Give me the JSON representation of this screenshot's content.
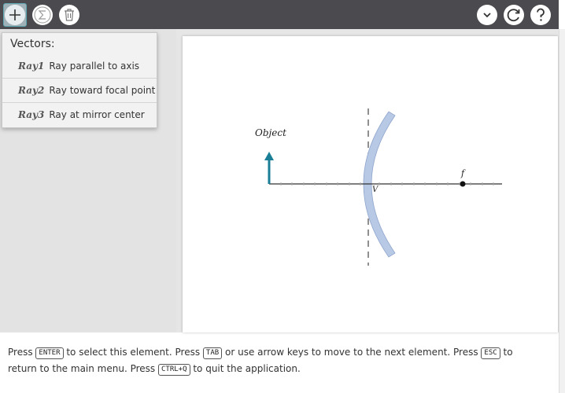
{
  "toolbar": {
    "add_icon": "plus-icon",
    "sum_icon": "sigma-icon",
    "delete_icon": "trash-icon",
    "dropdown_icon": "chevron-down-icon",
    "reset_icon": "refresh-icon",
    "help_icon": "question-icon"
  },
  "menu": {
    "title": "Vectors:",
    "items": [
      {
        "name": "Ray1",
        "label": "Ray parallel to axis"
      },
      {
        "name": "Ray2",
        "label": "Ray toward focal point"
      },
      {
        "name": "Ray3",
        "label": "Ray at mirror center"
      }
    ]
  },
  "diagram": {
    "object_label": "Object",
    "vertex_label": "V",
    "focal_label": "f",
    "mirror_color": "#b8c9e6",
    "object_color": "#1a7f96"
  },
  "status": {
    "p1": "Press",
    "k1": "ENTER",
    "p2": "to select this element. Press",
    "k2": "TAB",
    "p3": "or use arrow keys to move to the next element. Press",
    "k3": "ESC",
    "p4": "to return to the main menu. Press",
    "k4": "CTRL+Q",
    "p5": "to quit the application."
  }
}
